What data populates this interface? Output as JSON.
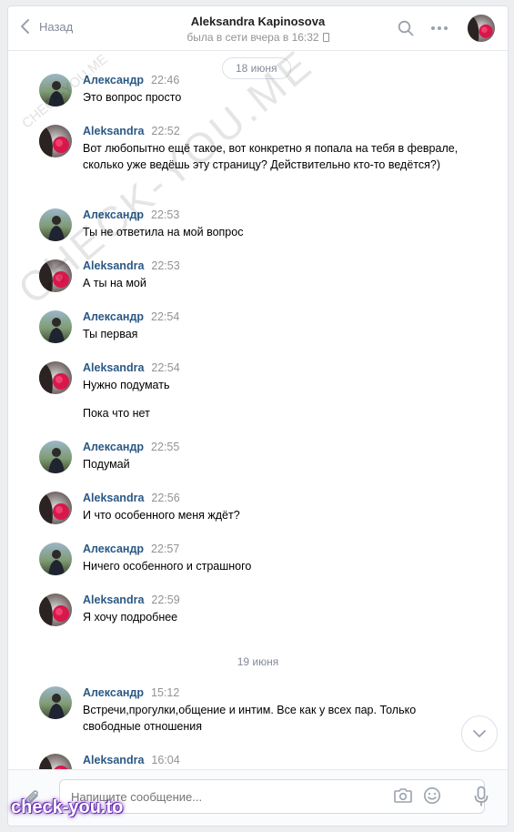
{
  "header": {
    "back_label": "Назад",
    "title": "Aleksandra Kapinosova",
    "status": "была в сети вчера в 16:32"
  },
  "dates": {
    "ghost": "18 июня",
    "sticky": "18 июня",
    "jun19": "19 июня"
  },
  "messages": [
    {
      "author": "Александр",
      "time": "22:46",
      "text": "Это вопрос просто",
      "avatar": "alexander"
    },
    {
      "author": "Aleksandra",
      "time": "22:52",
      "text": "Вот любопытно ещё такое, вот конкретно я попала на тебя в феврале, сколько уже ведёшь эту страницу? Действительно кто-то ведётся?)",
      "avatar": "aleksandra"
    },
    {
      "author": "Александр",
      "time": "22:53",
      "text": "Ты не ответила на мой вопрос",
      "avatar": "alexander"
    },
    {
      "author": "Aleksandra",
      "time": "22:53",
      "text": "А ты на мой",
      "avatar": "aleksandra"
    },
    {
      "author": "Александр",
      "time": "22:54",
      "text": "Ты первая",
      "avatar": "alexander"
    },
    {
      "author": "Aleksandra",
      "time": "22:54",
      "text": "Нужно подумать",
      "extra": "Пока что нет",
      "avatar": "aleksandra"
    },
    {
      "author": "Александр",
      "time": "22:55",
      "text": "Подумай",
      "avatar": "alexander"
    },
    {
      "author": "Aleksandra",
      "time": "22:56",
      "text": "И что особенного меня ждёт?",
      "avatar": "aleksandra"
    },
    {
      "author": "Александр",
      "time": "22:57",
      "text": "Ничего особенного и страшного",
      "avatar": "alexander"
    },
    {
      "author": "Aleksandra",
      "time": "22:59",
      "text": "Я хочу подробнее",
      "avatar": "aleksandra"
    },
    {
      "author": "Александр",
      "time": "15:12",
      "text": "Встречи,прогулки,общение и интим. Все как у всех пар. Только свободные отношения",
      "avatar": "alexander"
    },
    {
      "author": "Aleksandra",
      "time": "16:04",
      "text": "",
      "avatar": "aleksandra"
    }
  ],
  "composer": {
    "placeholder": "Напишите сообщение..."
  },
  "watermarks": {
    "diagonal": "CHECK-YOU.ME",
    "small": "CHECK-YOU.ME",
    "brand": "check-you.to"
  },
  "colors": {
    "author": "#2a5885",
    "muted": "#939393",
    "icon": "#99a2ad",
    "accent_brand": "#6b2fb3"
  },
  "icons": [
    "chevron-left-icon",
    "search-icon",
    "more-icon",
    "phone-icon",
    "attach-icon",
    "camera-icon",
    "emoji-icon",
    "microphone-icon",
    "chevron-down-icon"
  ]
}
